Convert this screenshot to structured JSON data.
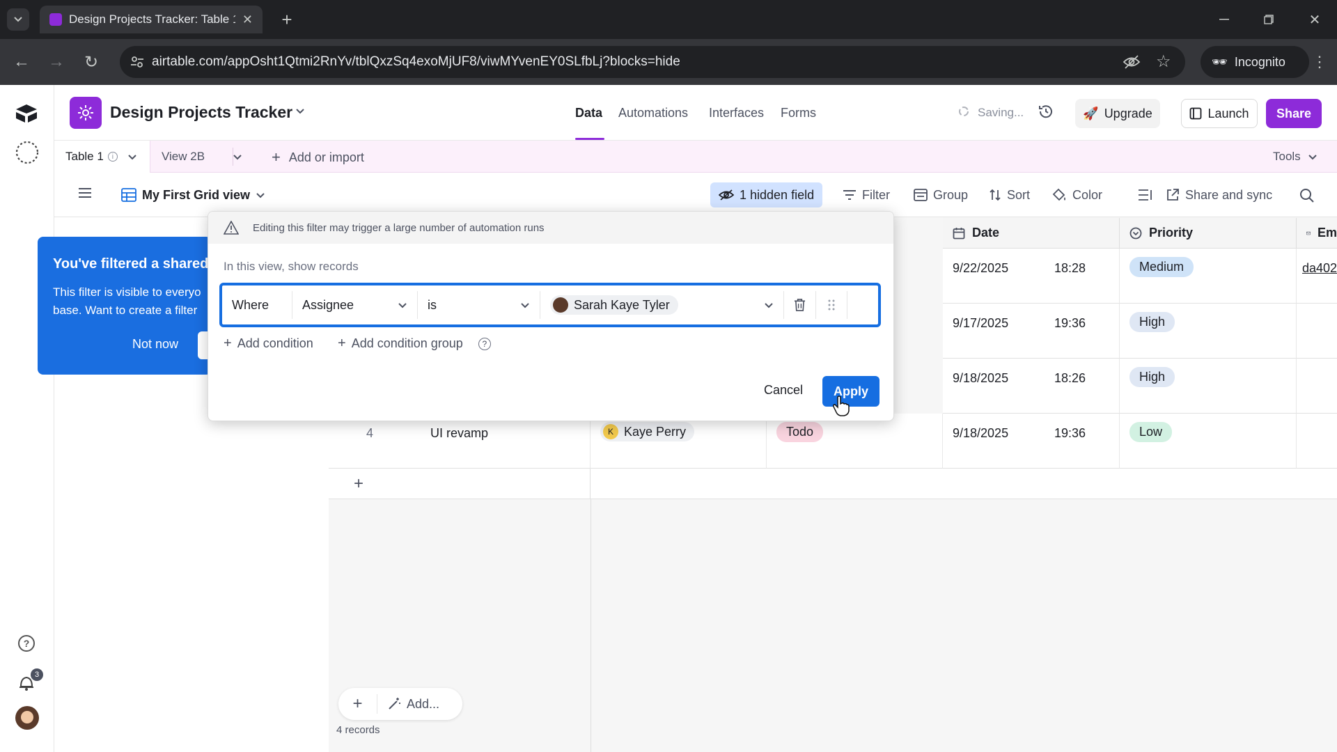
{
  "browser": {
    "tab_title": "Design Projects Tracker: Table 1",
    "url": "airtable.com/appOsht1Qtmi2RnYv/tblQxzSq4exoMjUF8/viwMYvenEY0SLfbLj?blocks=hide",
    "incognito_label": "Incognito"
  },
  "header": {
    "base_title": "Design Projects Tracker",
    "nav": [
      "Data",
      "Automations",
      "Interfaces",
      "Forms"
    ],
    "saving": "Saving...",
    "upgrade": "Upgrade",
    "launch": "Launch",
    "share": "Share"
  },
  "tabbar": {
    "table_tab": "Table 1",
    "view_tab": "View 2B",
    "add_import": "Add or import",
    "tools": "Tools"
  },
  "toolbar": {
    "view_name": "My First Grid view",
    "hidden_field": "1 hidden field",
    "filter": "Filter",
    "group": "Group",
    "sort": "Sort",
    "color": "Color",
    "share_sync": "Share and sync"
  },
  "banner": {
    "title": "You've filtered a shared",
    "body_line1": "This filter is visible to everyo",
    "body_line2": "base. Want to create a filter",
    "not_now": "Not now"
  },
  "filter_popup": {
    "warning": "Editing this filter may trigger a large number of automation runs",
    "intro": "In this view, show records",
    "where": "Where",
    "field": "Assignee",
    "operator": "is",
    "value": "Sarah Kaye Tyler",
    "add_condition": "Add condition",
    "add_condition_group": "Add condition group",
    "cancel": "Cancel",
    "apply": "Apply"
  },
  "grid": {
    "columns": {
      "date": "Date",
      "priority": "Priority",
      "email_partial": "Em"
    },
    "rows": [
      {
        "date": "9/22/2025",
        "time": "18:28",
        "priority": "Medium",
        "email": "da402"
      },
      {
        "date": "9/17/2025",
        "time": "19:36",
        "priority": "High"
      },
      {
        "date": "9/18/2025",
        "time": "18:26",
        "priority": "High"
      },
      {
        "num": "4",
        "name": "UI revamp",
        "assignee": "Kaye Perry",
        "assignee_initial": "K",
        "status": "Todo",
        "date": "9/18/2025",
        "time": "19:36",
        "priority": "Low"
      }
    ],
    "add_label": "Add...",
    "record_count": "4 records"
  },
  "rail": {
    "notif_count": "3"
  }
}
